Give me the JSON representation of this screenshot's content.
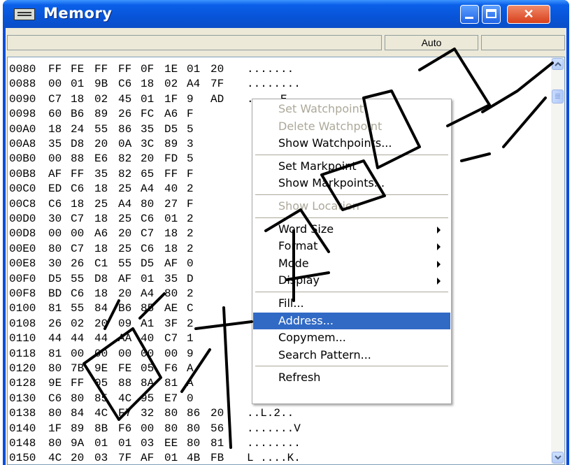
{
  "window": {
    "title": "Memory",
    "close_glyph": "✕"
  },
  "statusbar": {
    "mode": "Auto"
  },
  "memory_rows": [
    {
      "addr": "0080",
      "bytes": [
        "FF",
        "FE",
        "FF",
        "FF",
        "0F",
        "1E",
        "01",
        "20"
      ],
      "ascii": "......."
    },
    {
      "addr": "0088",
      "bytes": [
        "00",
        "01",
        "9B",
        "C6",
        "18",
        "02",
        "A4",
        "7F"
      ],
      "ascii": "........"
    },
    {
      "addr": "0090",
      "bytes": [
        "C7",
        "18",
        "02",
        "45",
        "01",
        "1F",
        "9",
        "AD"
      ],
      "ascii": ".....E.."
    },
    {
      "addr": "0098",
      "bytes": [
        "60",
        "B6",
        "89",
        "26",
        "FC",
        "A6",
        "F"
      ],
      "ascii": ""
    },
    {
      "addr": "00A0",
      "bytes": [
        "18",
        "24",
        "55",
        "86",
        "35",
        "D5",
        "5"
      ],
      "ascii": ""
    },
    {
      "addr": "00A8",
      "bytes": [
        "35",
        "D8",
        "20",
        "0A",
        "3C",
        "89",
        "3"
      ],
      "ascii": ""
    },
    {
      "addr": "00B0",
      "bytes": [
        "00",
        "88",
        "E6",
        "82",
        "20",
        "FD",
        "5"
      ],
      "ascii": ""
    },
    {
      "addr": "00B8",
      "bytes": [
        "AF",
        "FF",
        "35",
        "82",
        "65",
        "FF",
        "F"
      ],
      "ascii": ""
    },
    {
      "addr": "00C0",
      "bytes": [
        "ED",
        "C6",
        "18",
        "25",
        "A4",
        "40",
        "2"
      ],
      "ascii": ""
    },
    {
      "addr": "00C8",
      "bytes": [
        "C6",
        "18",
        "25",
        "A4",
        "80",
        "27",
        "F"
      ],
      "ascii": ""
    },
    {
      "addr": "00D0",
      "bytes": [
        "30",
        "C7",
        "18",
        "25",
        "C6",
        "01",
        "2"
      ],
      "ascii": ""
    },
    {
      "addr": "00D8",
      "bytes": [
        "00",
        "00",
        "A6",
        "20",
        "C7",
        "18",
        "2"
      ],
      "ascii": ""
    },
    {
      "addr": "00E0",
      "bytes": [
        "80",
        "C7",
        "18",
        "25",
        "C6",
        "18",
        "2"
      ],
      "ascii": ""
    },
    {
      "addr": "00E8",
      "bytes": [
        "30",
        "26",
        "C1",
        "55",
        "D5",
        "AF",
        "0"
      ],
      "ascii": ""
    },
    {
      "addr": "00F0",
      "bytes": [
        "D5",
        "55",
        "D8",
        "AF",
        "01",
        "35",
        "D"
      ],
      "ascii": ""
    },
    {
      "addr": "00F8",
      "bytes": [
        "BD",
        "C6",
        "18",
        "20",
        "A4",
        "80",
        "2"
      ],
      "ascii": ""
    },
    {
      "addr": "0100",
      "bytes": [
        "81",
        "55",
        "84",
        "B6",
        "85",
        "AE",
        "C"
      ],
      "ascii": ""
    },
    {
      "addr": "0108",
      "bytes": [
        "26",
        "02",
        "20",
        "09",
        "A1",
        "3F",
        "2"
      ],
      "ascii": ""
    },
    {
      "addr": "0110",
      "bytes": [
        "44",
        "44",
        "44",
        "AA",
        "40",
        "C7",
        "1"
      ],
      "ascii": ""
    },
    {
      "addr": "0118",
      "bytes": [
        "81",
        "00",
        "00",
        "00",
        "00",
        "00",
        "9"
      ],
      "ascii": ""
    },
    {
      "addr": "0120",
      "bytes": [
        "80",
        "7B",
        "9E",
        "FE",
        "05",
        "F6",
        "A"
      ],
      "ascii": ""
    },
    {
      "addr": "0128",
      "bytes": [
        "9E",
        "FF",
        "05",
        "88",
        "8A",
        "81",
        "A"
      ],
      "ascii": ""
    },
    {
      "addr": "0130",
      "bytes": [
        "C6",
        "80",
        "85",
        "4C",
        "95",
        "E7",
        "0"
      ],
      "ascii": ""
    },
    {
      "addr": "0138",
      "bytes": [
        "80",
        "84",
        "4C",
        "F7",
        "32",
        "80",
        "86",
        "20"
      ],
      "ascii": "..L.2.."
    },
    {
      "addr": "0140",
      "bytes": [
        "1F",
        "89",
        "8B",
        "F6",
        "00",
        "80",
        "80",
        "56"
      ],
      "ascii": ".......V"
    },
    {
      "addr": "0148",
      "bytes": [
        "80",
        "9A",
        "01",
        "01",
        "03",
        "EE",
        "80",
        "81"
      ],
      "ascii": "........"
    },
    {
      "addr": "0150",
      "bytes": [
        "4C",
        "20",
        "03",
        "7F",
        "AF",
        "01",
        "4B",
        "FB"
      ],
      "ascii": "L ....K."
    }
  ],
  "context_menu": [
    {
      "label": "Set Watchpoint",
      "disabled": true
    },
    {
      "label": "Delete Watchpoint",
      "disabled": true
    },
    {
      "label": "Show Watchpoints...",
      "disabled": false
    },
    {
      "separator": true
    },
    {
      "label": "Set Markpoint",
      "disabled": false
    },
    {
      "label": "Show Markpoints...",
      "disabled": false
    },
    {
      "separator": true
    },
    {
      "label": "Show Location",
      "disabled": true
    },
    {
      "separator": true
    },
    {
      "label": "Word Size",
      "disabled": false,
      "submenu": true
    },
    {
      "label": "Format",
      "disabled": false,
      "submenu": true
    },
    {
      "label": "Mode",
      "disabled": false,
      "submenu": true
    },
    {
      "label": "Display",
      "disabled": false,
      "submenu": true
    },
    {
      "separator": true
    },
    {
      "label": "Fill...",
      "disabled": false
    },
    {
      "label": "Address...",
      "disabled": false,
      "selected": true
    },
    {
      "label": "Copymem...",
      "disabled": false
    },
    {
      "label": "Search Pattern...",
      "disabled": false
    },
    {
      "separator": true
    },
    {
      "label": "Refresh",
      "disabled": false
    }
  ],
  "icons": {
    "window_icon": "memory-chip-icon",
    "scroll_up": "arrow-up-icon",
    "scroll_down": "arrow-down-icon",
    "submenu": "triangle-right-icon"
  },
  "colors": {
    "title_bar": "#0a5fe8",
    "menu_highlight": "#316ac5",
    "close_button": "#d8401a"
  }
}
